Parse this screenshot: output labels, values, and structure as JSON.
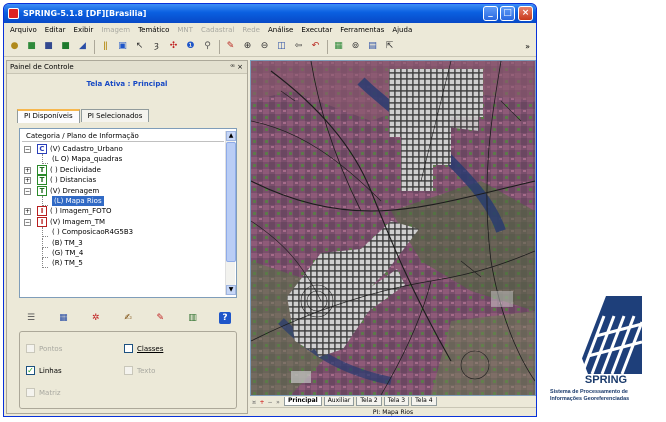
{
  "window": {
    "title": "SPRING-5.1.8 [DF][Brasilia]",
    "min_symbol": "_",
    "max_symbol": "□",
    "close_symbol": "×"
  },
  "menu": [
    {
      "label": "Arquivo",
      "enabled": true
    },
    {
      "label": "Editar",
      "enabled": true
    },
    {
      "label": "Exibir",
      "enabled": true
    },
    {
      "label": "Imagem",
      "enabled": false
    },
    {
      "label": "Temático",
      "enabled": true
    },
    {
      "label": "MNT",
      "enabled": false
    },
    {
      "label": "Cadastral",
      "enabled": false
    },
    {
      "label": "Rede",
      "enabled": false
    },
    {
      "label": "Análise",
      "enabled": true
    },
    {
      "label": "Executar",
      "enabled": true
    },
    {
      "label": "Ferramentas",
      "enabled": true
    },
    {
      "label": "Ajuda",
      "enabled": true
    }
  ],
  "toolbar": {
    "overflow": "»",
    "buttons": [
      {
        "icon": "database-icon",
        "glyph": "●",
        "color": "#b08a1c"
      },
      {
        "icon": "project-icon",
        "glyph": "■",
        "color": "#2f8a3a"
      },
      {
        "icon": "layer-icon",
        "glyph": "■",
        "color": "#33498f"
      },
      {
        "icon": "category-icon",
        "glyph": "■",
        "color": "#1e7a2c"
      },
      {
        "icon": "draw-icon",
        "glyph": "◢",
        "color": "#2a4ea6"
      },
      {
        "sep": true
      },
      {
        "icon": "scale-icon",
        "glyph": "ǁ",
        "color": "#b58d18"
      },
      {
        "icon": "screen-icon",
        "glyph": "▣",
        "color": "#1f56c9"
      },
      {
        "icon": "cursor-icon",
        "glyph": "↖",
        "color": "#333"
      },
      {
        "icon": "info-icon",
        "glyph": "ȝ",
        "color": "#222"
      },
      {
        "icon": "pan-icon",
        "glyph": "✣",
        "color": "#c02020"
      },
      {
        "icon": "query-icon",
        "glyph": "❶",
        "color": "#1f56c9"
      },
      {
        "icon": "search-icon",
        "glyph": "⚲",
        "color": "#555"
      },
      {
        "sep": true
      },
      {
        "icon": "pencil-icon",
        "glyph": "✎",
        "color": "#b8241c"
      },
      {
        "icon": "zoom-in-icon",
        "glyph": "⊕",
        "color": "#333"
      },
      {
        "icon": "zoom-out-icon",
        "glyph": "⊖",
        "color": "#333"
      },
      {
        "icon": "zoom-area-icon",
        "glyph": "◫",
        "color": "#2a4ea6"
      },
      {
        "icon": "previous-icon",
        "glyph": "⇦",
        "color": "#333"
      },
      {
        "icon": "undo-icon",
        "glyph": "↶",
        "color": "#b8241c"
      },
      {
        "sep": true
      },
      {
        "icon": "legend-icon",
        "glyph": "▦",
        "color": "#2f8a3a"
      },
      {
        "icon": "zoom-select-icon",
        "glyph": "⊚",
        "color": "#333"
      },
      {
        "icon": "grid-icon",
        "glyph": "▤",
        "color": "#2a4ea6"
      },
      {
        "icon": "cursor-help-icon",
        "glyph": "⇱",
        "color": "#333"
      }
    ]
  },
  "panel": {
    "title": "Painel de Controle",
    "pin": "ꟹ",
    "close": "×",
    "active_screen": "Tela Ativa : Principal",
    "tabs": [
      {
        "label": "PI Disponíveis",
        "active": true
      },
      {
        "label": "PI Selecionados",
        "active": false
      }
    ],
    "tree_header": "Categoria / Plano de Informação",
    "tree": [
      {
        "label": "(V) Cadastro_Urbano",
        "indent": 0,
        "expander": "⊟",
        "category": "C"
      },
      {
        "label": "(L O) Mapa_quadras",
        "indent": 1
      },
      {
        "label": "( ) Declividade",
        "indent": 0,
        "expander": "⊞",
        "category": "T"
      },
      {
        "label": "( ) Distancias",
        "indent": 0,
        "expander": "⊞",
        "category": "T"
      },
      {
        "label": "(V) Drenagem",
        "indent": 0,
        "expander": "⊟",
        "category": "T"
      },
      {
        "label": "(L) Mapa Rios",
        "indent": 1,
        "selected": true
      },
      {
        "label": "( ) Imagem_FOTO",
        "indent": 0,
        "expander": "⊞",
        "category": "I"
      },
      {
        "label": "(V) Imagem_TM",
        "indent": 0,
        "expander": "⊟",
        "category": "I"
      },
      {
        "label": "( ) ComposicaoR4G5B3",
        "indent": 1
      },
      {
        "label": "(B) TM_3",
        "indent": 1
      },
      {
        "label": "(G) TM_4",
        "indent": 1
      },
      {
        "label": "(R) TM_5",
        "indent": 1
      }
    ],
    "icon_toolbar": [
      {
        "icon": "list-icon",
        "glyph": "☰",
        "color": "#555"
      },
      {
        "icon": "table-icon",
        "glyph": "▦",
        "color": "#2a4ea6"
      },
      {
        "icon": "color-icon",
        "glyph": "✲",
        "color": "#c02020"
      },
      {
        "icon": "edit-visual-icon",
        "glyph": "✍",
        "color": "#7a4a0a"
      },
      {
        "icon": "pencil-icon",
        "glyph": "✎",
        "color": "#c02020"
      },
      {
        "icon": "select-icon",
        "glyph": "▥",
        "color": "#2a6e2a"
      },
      {
        "icon": "help-icon",
        "glyph": "?",
        "color": "#ffffff"
      }
    ],
    "representations": [
      {
        "label": "Pontos",
        "checked": false,
        "enabled": false,
        "col": 0,
        "row": 0
      },
      {
        "label": "Classes",
        "checked": false,
        "enabled": true,
        "col": 1,
        "row": 0
      },
      {
        "label": "Linhas",
        "checked": true,
        "enabled": true,
        "col": 0,
        "row": 1
      },
      {
        "label": "Texto",
        "checked": false,
        "enabled": false,
        "col": 1,
        "row": 1
      },
      {
        "label": "Matriz",
        "checked": false,
        "enabled": false,
        "col": 0,
        "row": 2
      }
    ]
  },
  "map": {
    "tabs": [
      {
        "label": "Principal",
        "active": true
      },
      {
        "label": "Auxiliar",
        "active": false
      },
      {
        "label": "Tela 2",
        "active": false
      },
      {
        "label": "Tela 3",
        "active": false
      },
      {
        "label": "Tela 4",
        "active": false
      }
    ],
    "nav_first": "¤",
    "nav_add": "+",
    "nav_remove": "−",
    "nav_next": "»",
    "status": "PI: Mapa Rios"
  },
  "logo": {
    "name": "SPRING",
    "subtitle_line1": "Sistema de Processamento de",
    "subtitle_line2": "Informações Georeferenciadas"
  }
}
